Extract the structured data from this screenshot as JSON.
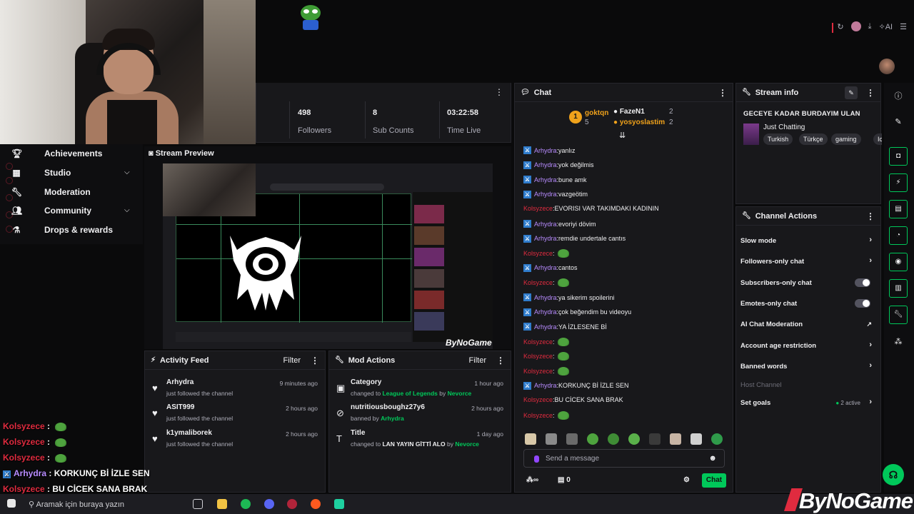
{
  "stats": {
    "followers_value": "498",
    "followers_label": "Followers",
    "subs_value": "8",
    "subs_label": "Sub Counts",
    "time_value": "03:22:58",
    "time_label": "Time Live"
  },
  "nav": {
    "items": [
      {
        "label": "Achievements",
        "icon": "trophy-icon"
      },
      {
        "label": "Studio",
        "icon": "studio-icon",
        "expandable": true
      },
      {
        "label": "Moderation",
        "icon": "wrench-icon"
      },
      {
        "label": "Community",
        "icon": "community-icon",
        "expandable": true
      },
      {
        "label": "Drops & rewards",
        "icon": "gift-icon"
      }
    ]
  },
  "preview": {
    "title": "Stream Preview",
    "brand": "ByNoGame"
  },
  "activity": {
    "title": "Activity Feed",
    "filter": "Filter",
    "items": [
      {
        "name": "Arhydra",
        "sub": "just followed the channel",
        "time": "9 minutes ago"
      },
      {
        "name": "ASIT999",
        "sub": "just followed the channel",
        "time": "2 hours ago"
      },
      {
        "name": "k1ymaliborek",
        "sub": "just followed the channel",
        "time": "2 hours ago"
      }
    ]
  },
  "modactions": {
    "title": "Mod Actions",
    "filter": "Filter",
    "items": [
      {
        "name": "Category",
        "pre": "changed to",
        "hl": "League of Legends",
        "mid": "by",
        "by": "Nevorce",
        "time": "1 hour ago"
      },
      {
        "name": "nutritiousboughz27y6",
        "pre": "banned by",
        "hl": "Arhydra",
        "mid": "",
        "by": "",
        "time": "2 hours ago"
      },
      {
        "name": "Title",
        "pre": "changed to",
        "hl": "LAN YAYIN GİTTİ ALO",
        "mid": "by",
        "by": "Nevorce",
        "time": "1 day ago"
      }
    ]
  },
  "chat": {
    "title": "Chat",
    "hype": {
      "leader_rank": "1",
      "leader_name": "goktqn",
      "leader_count": "5",
      "second_name": "FazeN1",
      "second_count": "2",
      "third_name": "yosyoslastim",
      "third_count": "2"
    },
    "messages": [
      {
        "user": "Arhydra",
        "text": "yanlız"
      },
      {
        "user": "Arhydra",
        "text": "yok değilmis"
      },
      {
        "user": "Arhydra",
        "text": "bune amk"
      },
      {
        "user": "Arhydra",
        "text": "vazgeötim"
      },
      {
        "user": "Kolsyzece",
        "text": "EVORISI VAR TAKIMDAKI KADININ"
      },
      {
        "user": "Arhydra",
        "text": "evoriyi dövim"
      },
      {
        "user": "Arhydra",
        "text": "remdie undertale cantıs"
      },
      {
        "user": "Kolsyzece",
        "text": ""
      },
      {
        "user": "Arhydra",
        "text": "cantos"
      },
      {
        "user": "Kolsyzece",
        "text": ""
      },
      {
        "user": "Arhydra",
        "text": "ya sikerim spoilerini"
      },
      {
        "user": "Arhydra",
        "text": "çok beğendim bu videoyu"
      },
      {
        "user": "Arhydra",
        "text": "YA İZLESENE Bİ"
      },
      {
        "user": "Kolsyzece",
        "text": ""
      },
      {
        "user": "Kolsyzece",
        "text": ""
      },
      {
        "user": "Kolsyzece",
        "text": ""
      },
      {
        "user": "Arhydra",
        "text": "KORKUNÇ Bİ İZLE SEN"
      },
      {
        "user": "Kolsyzece",
        "text": "BU CİCEK SANA BRAK"
      },
      {
        "user": "Kolsyzece",
        "text": ""
      }
    ],
    "placeholder": "Send a message",
    "points": "0",
    "send_label": "Chat"
  },
  "streaminfo": {
    "title": "Stream info",
    "stream_title": "GECEYE KADAR BURDAYIM ULAN",
    "category": "Just Chatting",
    "tags": [
      "Turkish",
      "Türkçe",
      "gaming",
      "Ic"
    ]
  },
  "channelactions": {
    "title": "Channel Actions",
    "items": [
      {
        "label": "Slow mode",
        "control": "chevron"
      },
      {
        "label": "Followers-only chat",
        "control": "chevron"
      },
      {
        "label": "Subscribers-only chat",
        "control": "toggle"
      },
      {
        "label": "Emotes-only chat",
        "control": "toggle"
      },
      {
        "label": "AI Chat Moderation",
        "control": "external"
      },
      {
        "label": "Account age restriction",
        "control": "chevron"
      },
      {
        "label": "Banned words",
        "control": "chevron"
      },
      {
        "label": "Host Channel",
        "control": "none"
      },
      {
        "label": "Set goals",
        "control": "chevron"
      }
    ],
    "goals_status": "2 active"
  },
  "overlay": {
    "lines": [
      {
        "user": "Kolsyzece",
        "text": ""
      },
      {
        "user": "Kolsyzece",
        "text": ""
      },
      {
        "user": "Kolsyzece",
        "text": ""
      },
      {
        "user": "Arhydra",
        "text": "KORKUNÇ Bİ İZLE SEN"
      },
      {
        "user": "Kolsyzece",
        "text": "BU CİCEK SANA BRAK"
      }
    ]
  },
  "taskbar": {
    "search_placeholder": "Aramak için buraya yazın"
  },
  "topbar": {
    "ai_label": "AI"
  },
  "brand": "ByNoGame",
  "colors": {
    "accent": "#00c85a",
    "purple": "#9147ff",
    "red": "#e02b3f"
  }
}
